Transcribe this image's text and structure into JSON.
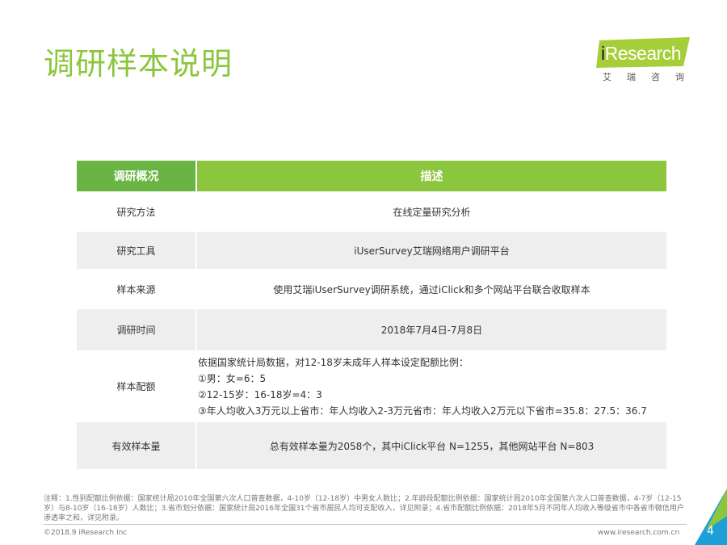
{
  "page": {
    "title": "调研样本说明",
    "page_number": "4"
  },
  "logo": {
    "brand_i": "i",
    "brand_rest": "Research",
    "subtitle": "艾瑞咨询",
    "colors": {
      "green": "#a6ce39",
      "dark": "#1a1a1a"
    }
  },
  "table": {
    "headers": [
      "调研概况",
      "描述"
    ],
    "rows": [
      {
        "label": "研究方法",
        "desc": "在线定量研究分析"
      },
      {
        "label": "研究工具",
        "desc": "iUserSurvey艾瑞网络用户调研平台"
      },
      {
        "label": "样本来源",
        "desc": "使用艾瑞iUserSurvey调研系统，通过iClick和多个网站平台联合收取样本"
      },
      {
        "label": "调研时间",
        "desc": "2018年7月4日-7月8日"
      },
      {
        "label": "样本配额",
        "desc_lines": [
          "依据国家统计局数据，对12-18岁未成年人样本设定配额比例：",
          "①男：女=6：5",
          "②12-15岁：16-18岁=4：3",
          "③年人均收入3万元以上省市：年人均收入2-3万元省市：年人均收入2万元以下省市=35.8：27.5：36.7"
        ]
      },
      {
        "label": "有效样本量",
        "desc": "总有效样本量为2058个，其中iClick平台 N=1255，其他网站平台 N=803"
      }
    ]
  },
  "note": "注释：1.性别配额比例依据：国家统计局2010年全国第六次人口普查数据，4-10岁（12-18岁）中男女人数比；2.年龄段配额比例依据：国家统计局2010年全国第六次人口普查数据，4-7岁（12-15岁）与8-10岁（16-18岁）人数比；3.省市划分依据：国家统计局2016年全国31个省市居民人均可支配收入，详见附录；4.省市配额比例依据：2018年5月不同年人均收入等级省市中各省市微信用户渗透率之和，详见附录。",
  "footer": {
    "copyright": "©2018.9 iResearch Inc",
    "website": "www.iresearch.com.cn"
  },
  "colors": {
    "title_green": "#8cc63f",
    "header_dark_green": "#6ab443",
    "header_green": "#8cc63f",
    "row_gray": "#eeeeee",
    "corner_blue": "#1e9fd8"
  }
}
